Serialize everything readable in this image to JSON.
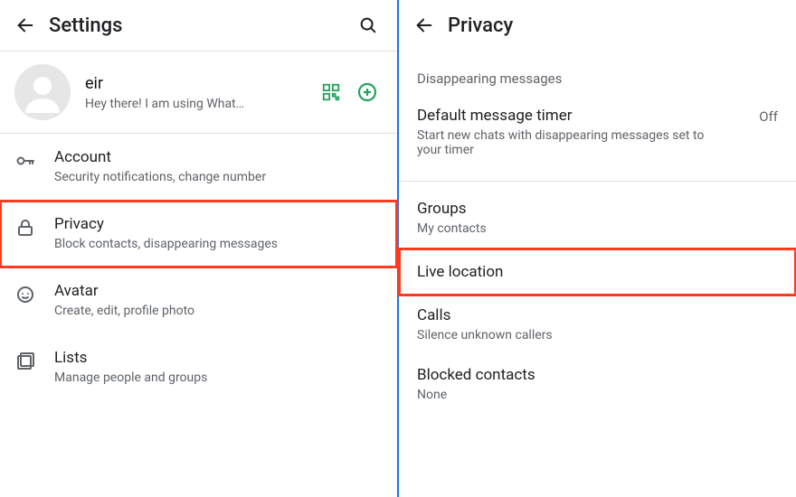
{
  "left": {
    "header": {
      "title": "Settings"
    },
    "profile": {
      "name": "eir",
      "status": "Hey there! I am using What…"
    },
    "items": [
      {
        "title": "Account",
        "subtitle": "Security notifications, change number"
      },
      {
        "title": "Privacy",
        "subtitle": "Block contacts, disappearing messages"
      },
      {
        "title": "Avatar",
        "subtitle": "Create, edit, profile photo"
      },
      {
        "title": "Lists",
        "subtitle": "Manage people and groups"
      }
    ]
  },
  "right": {
    "header": {
      "title": "Privacy"
    },
    "section_label": "Disappearing messages",
    "timer": {
      "title": "Default message timer",
      "subtitle": "Start new chats with disappearing messages set to your timer",
      "value": "Off"
    },
    "items": [
      {
        "title": "Groups",
        "subtitle": "My contacts"
      },
      {
        "title": "Live location",
        "subtitle": ""
      },
      {
        "title": "Calls",
        "subtitle": "Silence unknown callers"
      },
      {
        "title": "Blocked contacts",
        "subtitle": "None"
      }
    ]
  }
}
